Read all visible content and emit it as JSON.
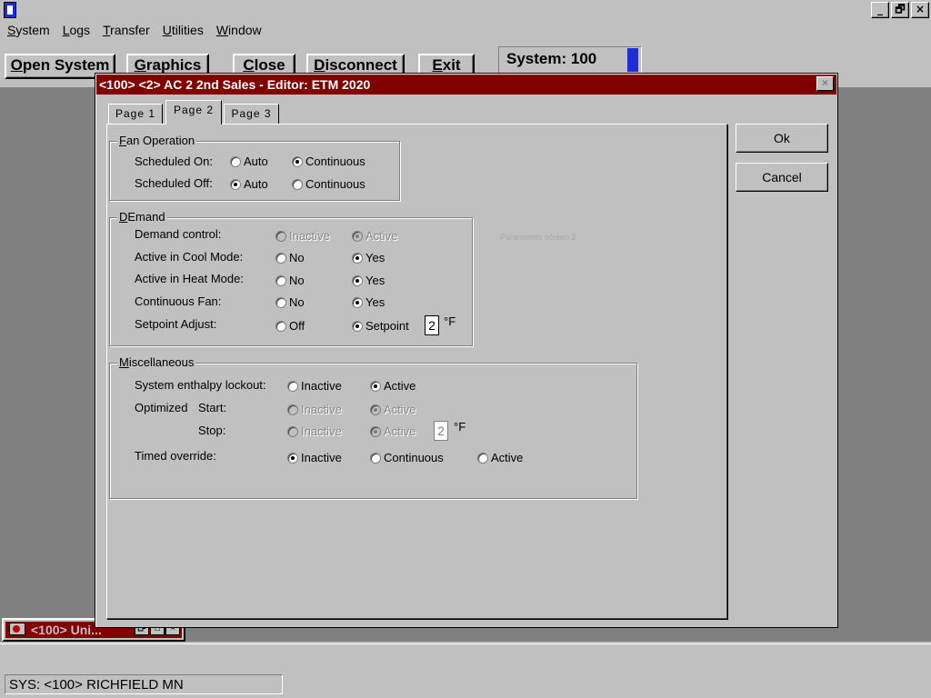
{
  "app": {
    "win_buttons": [
      "_",
      "🗗",
      "×"
    ],
    "menu": [
      "System",
      "Logs",
      "Transfer",
      "Utilities",
      "Window"
    ],
    "toolbar": {
      "open_system": "Open System",
      "graphics": "Graphics",
      "close": "Close",
      "disconnect": "Disconnect",
      "exit": "Exit"
    },
    "system_box": "System: 100",
    "minimized_window": {
      "title": "<100> Uni...",
      "buttons": [
        "🗗",
        "□",
        "×"
      ]
    },
    "status_text": "SYS: <100> RICHFIELD MN",
    "accent_color": "#800000"
  },
  "dialog": {
    "title": "<100> <2> AC 2 2nd Sales - Editor: ETM 2020",
    "close_glyph": "×",
    "tabs": [
      "Page 1",
      "Page 2",
      "Page 3"
    ],
    "active_tab": "Page 2",
    "ok_label": "Ok",
    "cancel_label": "Cancel",
    "faint_note": "Parameters screen 2",
    "fan_operation": {
      "label": "Fan Operation",
      "scheduled_on": {
        "label": "Scheduled On:",
        "opt1": "Auto",
        "opt2": "Continuous",
        "selected": "Continuous"
      },
      "scheduled_off": {
        "label": "Scheduled Off:",
        "opt1": "Auto",
        "opt2": "Continuous",
        "selected": "Auto"
      }
    },
    "demand": {
      "label": "DEmand",
      "demand_control": {
        "label": "Demand control:",
        "opt1": "Inactive",
        "opt2": "Active",
        "selected": "Active",
        "disabled": true
      },
      "cool_mode": {
        "label": "Active in Cool Mode:",
        "opt1": "No",
        "opt2": "Yes",
        "selected": "Yes"
      },
      "heat_mode": {
        "label": "Active in Heat Mode:",
        "opt1": "No",
        "opt2": "Yes",
        "selected": "Yes"
      },
      "continuous_fan": {
        "label": "Continuous Fan:",
        "opt1": "No",
        "opt2": "Yes",
        "selected": "Yes"
      },
      "setpoint_adjust": {
        "label": "Setpoint Adjust:",
        "opt1": "Off",
        "opt2": "Setpoint",
        "selected": "Setpoint",
        "value": "2",
        "unit": "°F"
      }
    },
    "misc": {
      "label": "Miscellaneous",
      "enthalpy": {
        "label": "System enthalpy lockout:",
        "opt1": "Inactive",
        "opt2": "Active",
        "selected": "Active"
      },
      "optimized_label": "Optimized",
      "start": {
        "label": "Start:",
        "opt1": "Inactive",
        "opt2": "Active",
        "selected": "Active",
        "disabled": true
      },
      "stop": {
        "label": "Stop:",
        "opt1": "Inactive",
        "opt2": "Active",
        "selected": "Active",
        "disabled": true,
        "value": "2",
        "unit": "°F"
      },
      "timed_override": {
        "label": "Timed override:",
        "opt1": "Inactive",
        "opt2": "Continuous",
        "opt3": "Active",
        "selected": "Inactive"
      }
    }
  }
}
